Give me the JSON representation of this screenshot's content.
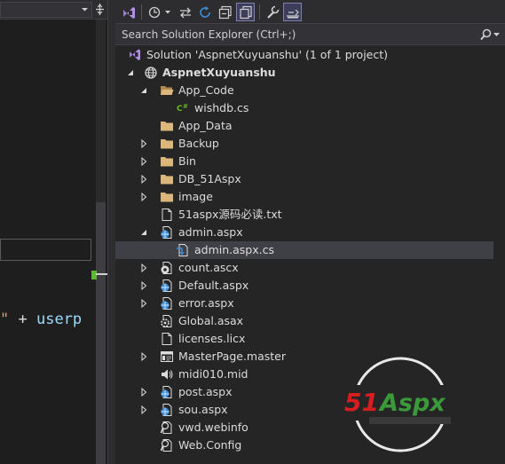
{
  "editor": {
    "code_prefix": "\"",
    "code_operator": " + ",
    "code_identifier": "userp"
  },
  "toolbar": {
    "buttons": [
      {
        "icon": "vs-home-icon"
      },
      {
        "icon": "history-icon"
      },
      {
        "icon": "sync-arrows-icon"
      },
      {
        "icon": "refresh-icon"
      },
      {
        "icon": "collapse-all-icon"
      },
      {
        "icon": "show-all-files-icon",
        "active": true
      },
      {
        "icon": "properties-wrench-icon"
      },
      {
        "icon": "preview-selected-icon",
        "active": true
      }
    ]
  },
  "search": {
    "placeholder": "Search Solution Explorer (Ctrl+;)"
  },
  "tree": {
    "solution_label": "Solution 'AspnetXuyuanshu' (1 of 1 project)",
    "project_label": "AspnetXuyuanshu",
    "items": [
      {
        "label": "App_Code"
      },
      {
        "label": "wishdb.cs"
      },
      {
        "label": "App_Data"
      },
      {
        "label": "Backup"
      },
      {
        "label": "Bin"
      },
      {
        "label": "DB_51Aspx"
      },
      {
        "label": "image"
      },
      {
        "label": "51aspx源码必读.txt"
      },
      {
        "label": "admin.aspx"
      },
      {
        "label": "admin.aspx.cs"
      },
      {
        "label": "count.ascx"
      },
      {
        "label": "Default.aspx"
      },
      {
        "label": "error.aspx"
      },
      {
        "label": "Global.asax"
      },
      {
        "label": "licenses.licx"
      },
      {
        "label": "MasterPage.master"
      },
      {
        "label": "midi010.mid"
      },
      {
        "label": "post.aspx"
      },
      {
        "label": "sou.aspx"
      },
      {
        "label": "vwd.webinfo"
      },
      {
        "label": "Web.Config"
      }
    ]
  },
  "watermark": {
    "brand_51": "51",
    "brand_aspx": "Aspx"
  },
  "colors": {
    "background": "#252526",
    "selected_row": "#3f3f46",
    "folder": "#dcb67a",
    "web_file": "#3c8fd8",
    "cs_badge": "#68b723"
  }
}
